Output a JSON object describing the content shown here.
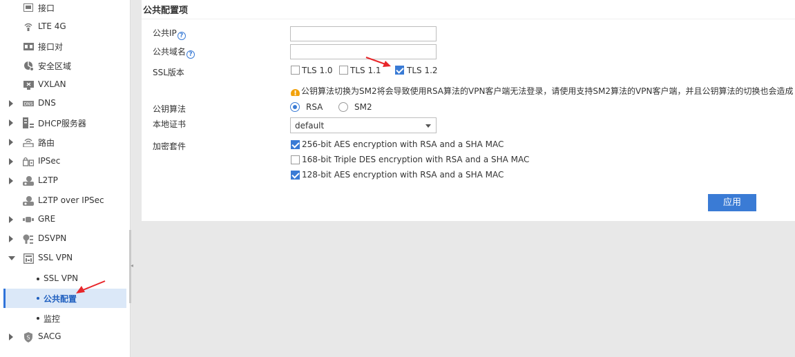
{
  "sidebar": {
    "items": [
      {
        "label": "接口",
        "icon": "interface-icon",
        "expandable": false
      },
      {
        "label": "LTE 4G",
        "icon": "signal-icon",
        "expandable": false
      },
      {
        "label": "接口对",
        "icon": "interface-pair-icon",
        "expandable": false
      },
      {
        "label": "安全区域",
        "icon": "security-zone-icon",
        "expandable": false
      },
      {
        "label": "VXLAN",
        "icon": "vxlan-icon",
        "expandable": false
      },
      {
        "label": "DNS",
        "icon": "dns-icon",
        "expandable": true
      },
      {
        "label": "DHCP服务器",
        "icon": "dhcp-server-icon",
        "expandable": true
      },
      {
        "label": "路由",
        "icon": "router-icon",
        "expandable": true
      },
      {
        "label": "IPSec",
        "icon": "ipsec-icon",
        "expandable": true
      },
      {
        "label": "L2TP",
        "icon": "l2tp-icon",
        "expandable": true
      },
      {
        "label": "L2TP over IPSec",
        "icon": "l2tp-over-ipsec-icon",
        "expandable": false
      },
      {
        "label": "GRE",
        "icon": "gre-icon",
        "expandable": true
      },
      {
        "label": "DSVPN",
        "icon": "dsvpn-icon",
        "expandable": true
      },
      {
        "label": "SSL VPN",
        "icon": "ssl-vpn-icon",
        "expandable": true,
        "expanded": true
      }
    ],
    "ssl_sub": [
      {
        "label": "SSL VPN"
      },
      {
        "label": "公共配置",
        "active": true
      },
      {
        "label": "监控"
      }
    ],
    "last_item": {
      "label": "SACG",
      "icon": "sacg-shield-icon"
    }
  },
  "panel": {
    "title": "公共配置项",
    "public_ip": {
      "label": "公共IP",
      "value": ""
    },
    "public_domain": {
      "label": "公共域名",
      "value": ""
    },
    "ssl_version": {
      "label": "SSL版本",
      "options": [
        {
          "label": "TLS 1.0",
          "checked": false
        },
        {
          "label": "TLS 1.1",
          "checked": false
        },
        {
          "label": "TLS 1.2",
          "checked": true
        }
      ]
    },
    "warning": "公钥算法切换为SM2将会导致使用RSA算法的VPN客户端无法登录，请使用支持SM2算法的VPN客户端，并且公钥算法的切换也会造成",
    "key_algorithm": {
      "label": "公钥算法",
      "options": [
        {
          "label": "RSA",
          "checked": true
        },
        {
          "label": "SM2",
          "checked": false
        }
      ]
    },
    "local_cert": {
      "label": "本地证书",
      "value": "default"
    },
    "cipher_suite": {
      "label": "加密套件",
      "options": [
        {
          "label": "256-bit AES encryption with RSA and a SHA MAC",
          "checked": true
        },
        {
          "label": "168-bit Triple DES encryption with RSA and a SHA MAC",
          "checked": false
        },
        {
          "label": "128-bit AES encryption with RSA and a SHA MAC",
          "checked": true
        }
      ]
    },
    "apply_label": "应用"
  },
  "colors": {
    "accent": "#3a7bd5",
    "annotation_arrow": "#e8262a",
    "warning": "#f2a20c"
  }
}
